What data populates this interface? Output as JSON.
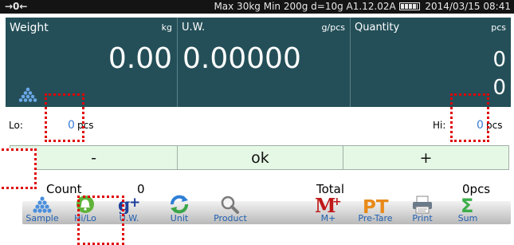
{
  "status": {
    "mode_symbols": "→0←",
    "info": "Max 30kg  Min 200g  d=10g    A1.12.02A",
    "date": "2014/03/15",
    "time": "08:41"
  },
  "weight": {
    "label": "Weight",
    "unit": "kg",
    "value": "0.00"
  },
  "uw": {
    "label": "U.W.",
    "unit": "g/pcs",
    "value": "0.00000"
  },
  "quantity": {
    "label": "Quantity",
    "unit": "pcs",
    "value1": "0",
    "value2": "0"
  },
  "limits": {
    "lo_label": "Lo:",
    "lo_value": "0",
    "lo_unit": "pcs",
    "hi_label": "Hi:",
    "hi_value": "0",
    "hi_unit": "pcs"
  },
  "buttons": {
    "minus": "-",
    "ok": "ok",
    "plus": "+"
  },
  "totals": {
    "count_label": "Count",
    "count_value": "0",
    "total_label": "Total",
    "total_value": "0pcs"
  },
  "dock": [
    {
      "label": "Sample",
      "icon": "sample-icon"
    },
    {
      "label": "Hi/Lo",
      "icon": "bell-icon"
    },
    {
      "label": "U.W.",
      "icon": "gplus-icon"
    },
    {
      "label": "Unit",
      "icon": "refresh-icon"
    },
    {
      "label": "Product",
      "icon": "magnifier-icon"
    },
    {
      "label": "M+",
      "icon": "memory-plus-icon"
    },
    {
      "label": "Pre-Tare",
      "icon": "pretare-icon"
    },
    {
      "label": "Print",
      "icon": "printer-icon"
    },
    {
      "label": "Sum",
      "icon": "sigma-icon"
    }
  ],
  "colors": {
    "panel": "#244f58",
    "accent_blue": "#3a7bd5",
    "button_bg": "#e5f8e5",
    "highlight": "#e00000"
  }
}
